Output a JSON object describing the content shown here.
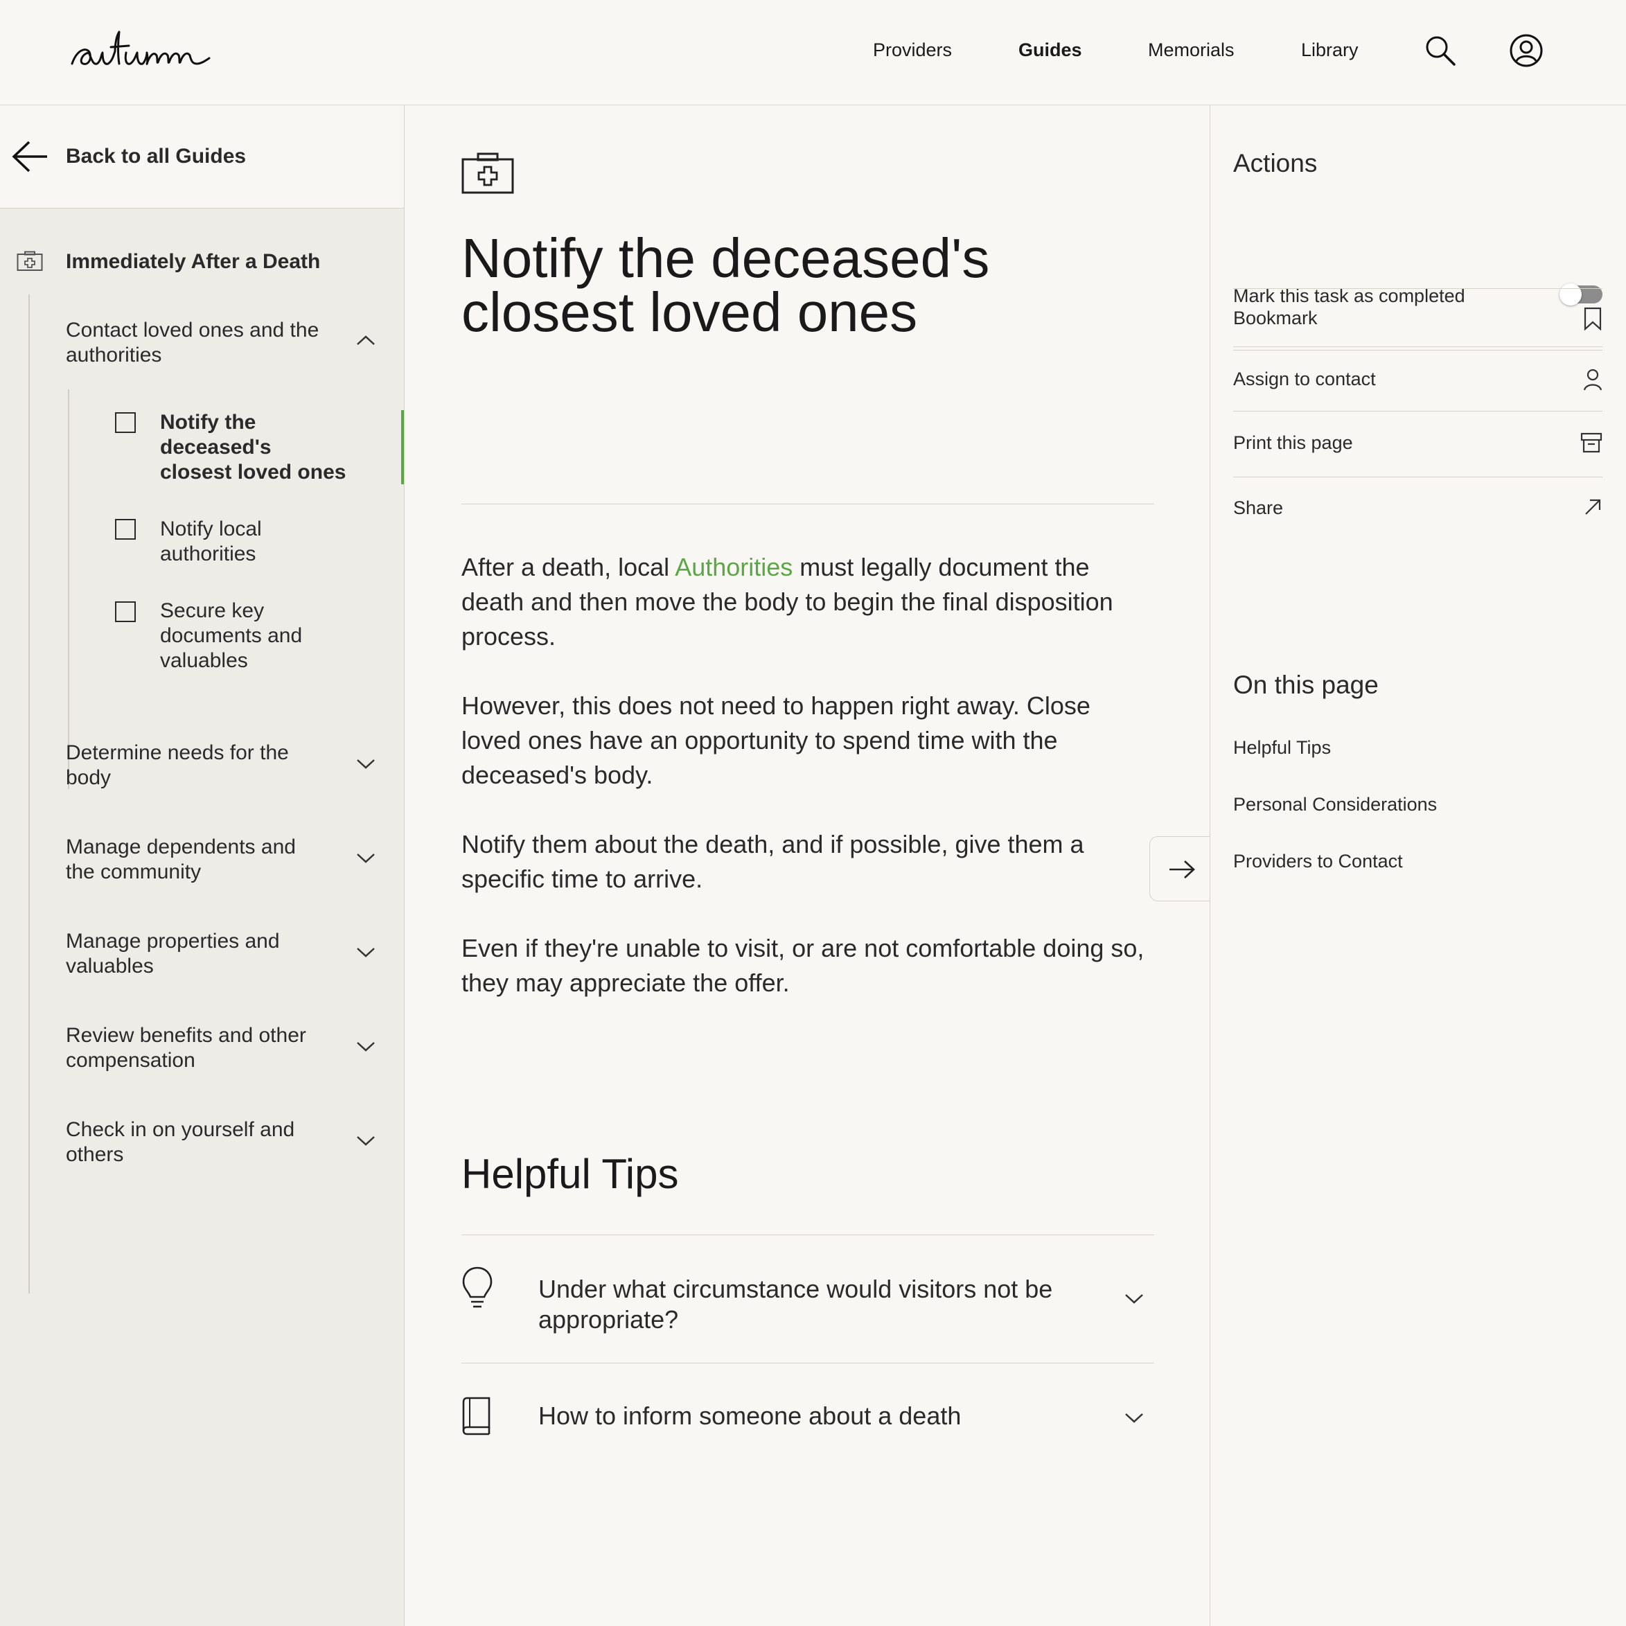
{
  "header": {
    "logo_text": "autumn",
    "nav": [
      "Providers",
      "Guides",
      "Memorials",
      "Library"
    ],
    "active_nav": "Guides",
    "icons": [
      "search-icon",
      "account-icon"
    ]
  },
  "sidebar": {
    "back_label": "Back to all Guides",
    "section_title": "Immediately After a Death",
    "section_icon": "first-aid-kit-icon",
    "groups": [
      {
        "label": "Contact loved ones and the authorities",
        "expanded": true,
        "tasks": [
          {
            "label": "Notify the deceased's closest loved ones",
            "active": true,
            "checked": false
          },
          {
            "label": "Notify local authorities",
            "active": false,
            "checked": false
          },
          {
            "label": "Secure key documents and valuables",
            "active": false,
            "checked": false
          }
        ]
      },
      {
        "label": "Determine needs for the body",
        "expanded": false
      },
      {
        "label": "Manage dependents and the community",
        "expanded": false
      },
      {
        "label": "Manage properties and valuables",
        "expanded": false
      },
      {
        "label": "Review benefits and other compensation",
        "expanded": false
      },
      {
        "label": "Check in on yourself and others",
        "expanded": false
      }
    ],
    "active_color": "#5ca745"
  },
  "main": {
    "icon": "first-aid-kit-icon",
    "title": "Notify the deceased's closest loved ones",
    "para1": {
      "before": "After a death, local ",
      "link": "Authorities",
      "after": " must legally document the death and then move the body to begin the final disposition process."
    },
    "para2": "However, this does not need to happen right away. Close loved ones have an opportunity to spend time with the deceased's body.",
    "para3": "Notify them about the death, and if possible, give them a specific time to arrive.",
    "para4": "Even if they're unable to visit, or are not comfortable doing so, they may appreciate the offer.",
    "helpful_tips_title": "Helpful Tips",
    "tips": [
      {
        "icon": "lightbulb-icon",
        "question": "Under what circumstance would visitors not be appropriate?"
      },
      {
        "icon": "book-icon",
        "question": "How to inform someone about a death"
      }
    ],
    "next_icon": "arrow-right-icon",
    "link_color": "#5ca745"
  },
  "right": {
    "actions_heading": "Actions",
    "actions": {
      "mark_completed": "Mark this task as completed",
      "mark_completed_on": false,
      "bookmark": "Bookmark",
      "assign": "Assign to contact",
      "print": "Print this page",
      "share": "Share"
    },
    "on_this_page_heading": "On this page",
    "on_this_page": [
      "Helpful Tips",
      "Personal Considerations",
      "Providers to Contact"
    ]
  }
}
